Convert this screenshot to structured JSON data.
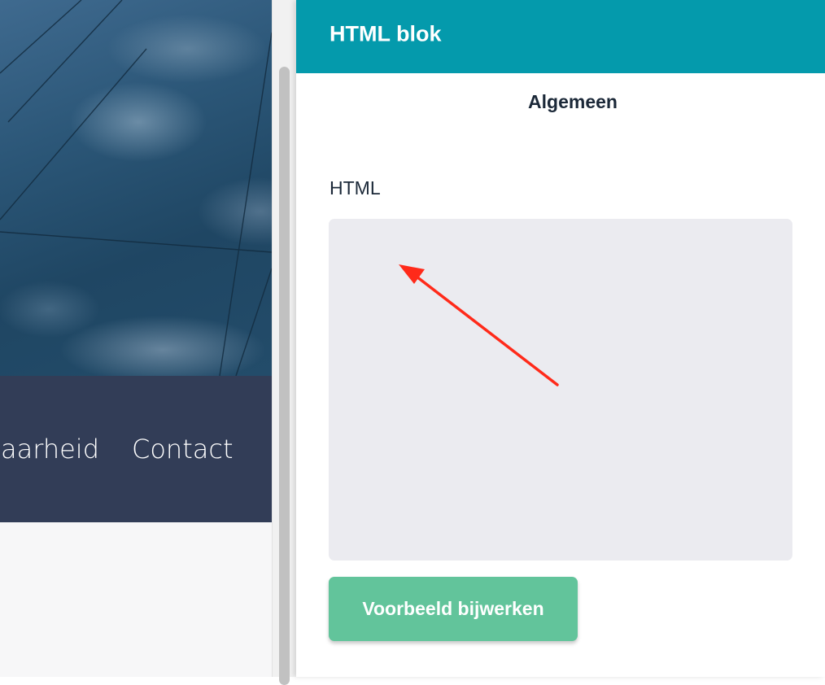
{
  "preview": {
    "nav": {
      "partial_item": "baarheid",
      "contact": "Contact"
    }
  },
  "panel": {
    "title": "HTML blok",
    "tab_general": "Algemeen",
    "html_field": {
      "label": "HTML",
      "value": ""
    },
    "update_button": "Voorbeeld bijwerken"
  },
  "colors": {
    "header_bg": "#049aac",
    "button_bg": "#62c49b",
    "nav_bg": "#323d57",
    "annotation_arrow": "#ff2a1a"
  },
  "icons": {
    "annotation": "red-arrow"
  }
}
